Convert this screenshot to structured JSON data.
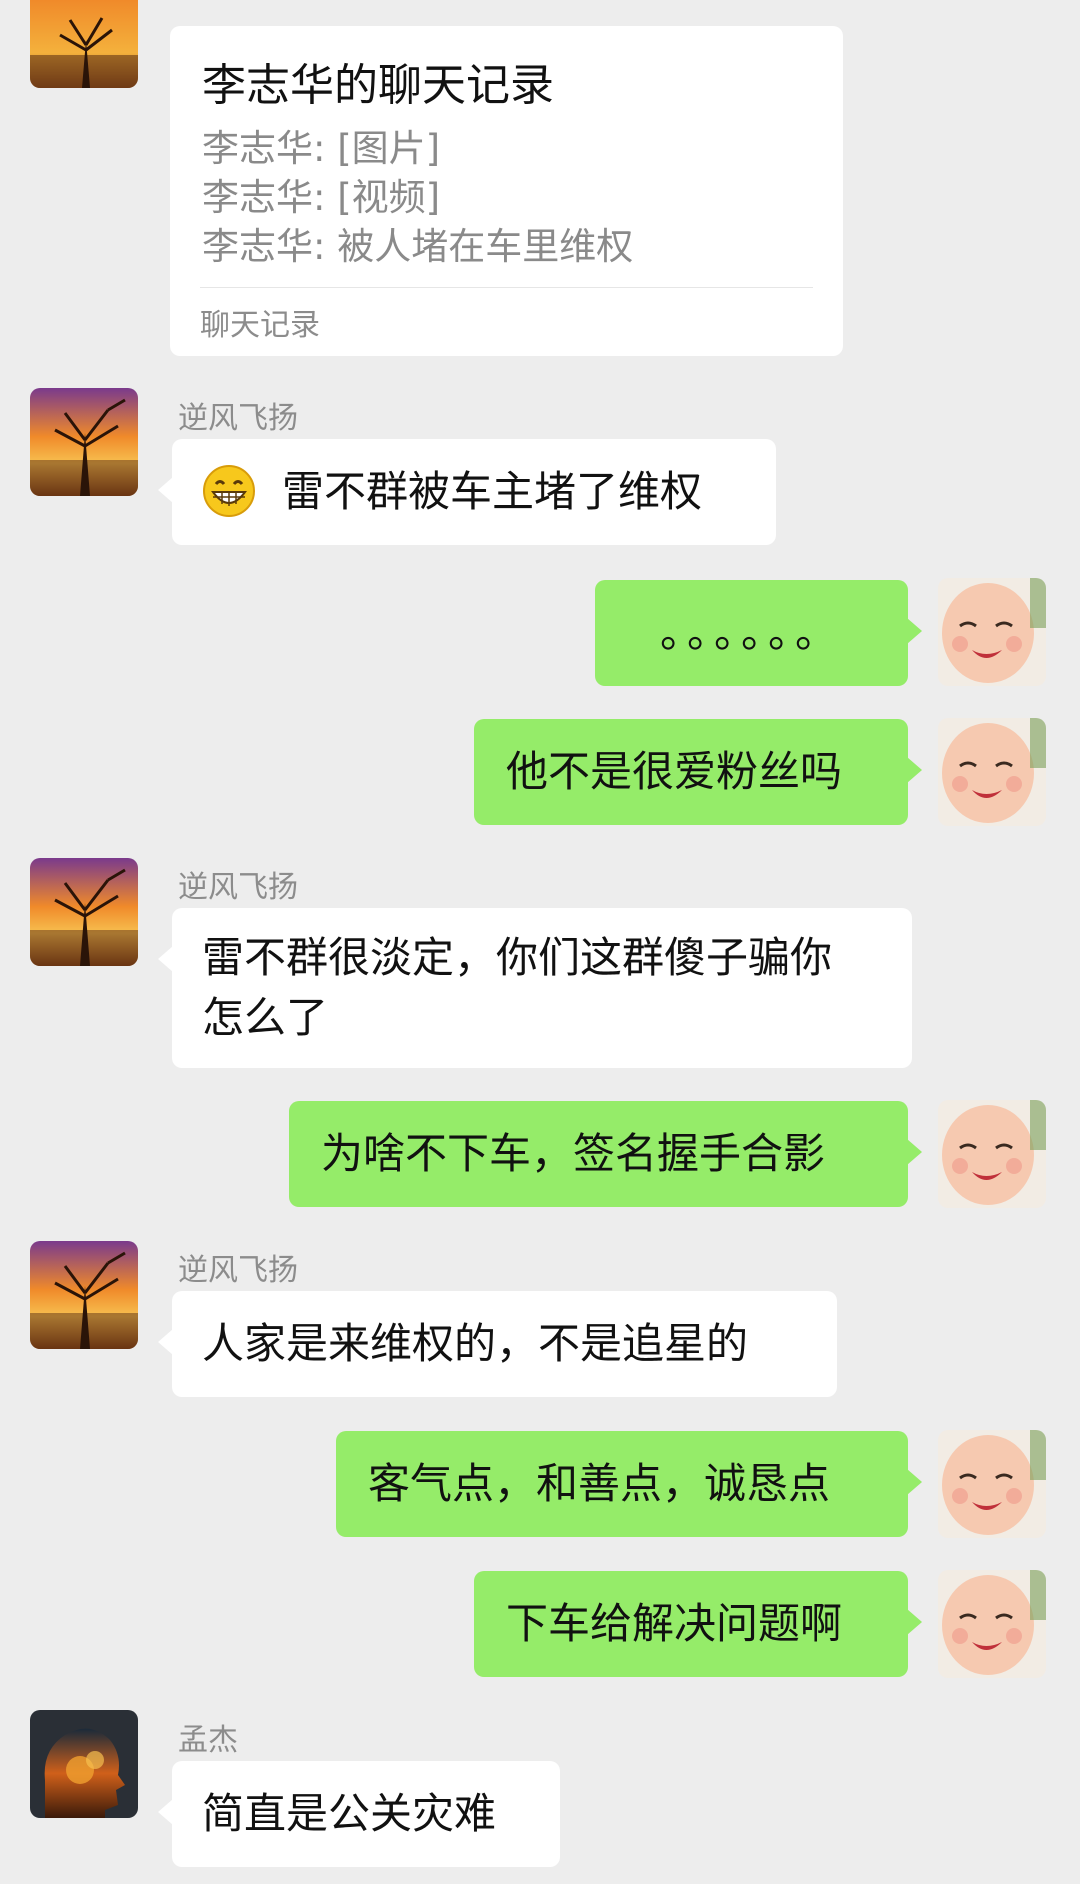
{
  "forwarded_card": {
    "title": "李志华的聊天记录",
    "lines": [
      "李志华: [图片]",
      "李志华: [视频]",
      "李志华: 被人堵在车里维权"
    ],
    "footer": "聊天记录"
  },
  "messages": [
    {
      "side": "left",
      "sender": "逆风飞扬",
      "avatar": "sunset-tree-avatar",
      "emoji": "grinning-face-icon",
      "text": "雷不群被车主堵了维权"
    },
    {
      "side": "right",
      "avatar": "baby-avatar",
      "text": "。。。。。。"
    },
    {
      "side": "right",
      "avatar": "baby-avatar",
      "text": "他不是很爱粉丝吗"
    },
    {
      "side": "left",
      "sender": "逆风飞扬",
      "avatar": "sunset-tree-avatar",
      "text_lines": [
        "雷不群很淡定，你们这群傻子骗你",
        "怎么了"
      ]
    },
    {
      "side": "right",
      "avatar": "baby-avatar",
      "text": "为啥不下车，签名握手合影"
    },
    {
      "side": "left",
      "sender": "逆风飞扬",
      "avatar": "sunset-tree-avatar",
      "text": "人家是来维权的，不是追星的"
    },
    {
      "side": "right",
      "avatar": "baby-avatar",
      "text": "客气点，和善点，诚恳点"
    },
    {
      "side": "right",
      "avatar": "baby-avatar",
      "text": "下车给解决问题啊"
    },
    {
      "side": "left",
      "sender": "孟杰",
      "avatar": "silhouette-fire-avatar",
      "text": "简直是公关灾难"
    }
  ],
  "colors": {
    "background": "#ededed",
    "left_bubble": "#ffffff",
    "right_bubble": "#95ec69",
    "sender_name": "#8c8c8c"
  }
}
